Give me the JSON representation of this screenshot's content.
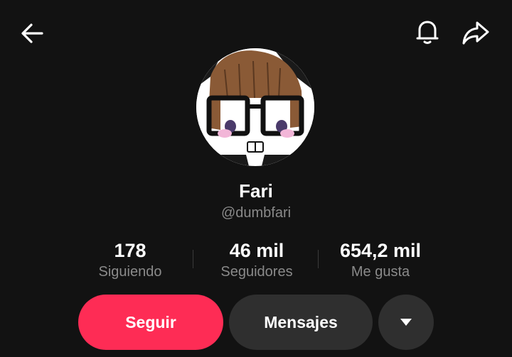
{
  "header": {
    "back_icon": "arrow-left-icon",
    "bell_icon": "bell-icon",
    "share_icon": "share-arrow-icon"
  },
  "profile": {
    "name": "Fari",
    "handle": "@dumbfari",
    "avatar": "anime-avatar-with-glasses"
  },
  "stats": [
    {
      "value": "178",
      "label": "Siguiendo"
    },
    {
      "value": "46 mil",
      "label": "Seguidores"
    },
    {
      "value": "654,2 mil",
      "label": "Me gusta"
    }
  ],
  "actions": {
    "follow_label": "Seguir",
    "message_label": "Mensajes",
    "more_icon": "caret-down-icon"
  },
  "colors": {
    "background": "#121212",
    "accent": "#fe2c55",
    "secondary_button": "#2f2f2f",
    "muted_text": "#8a8a8a"
  }
}
